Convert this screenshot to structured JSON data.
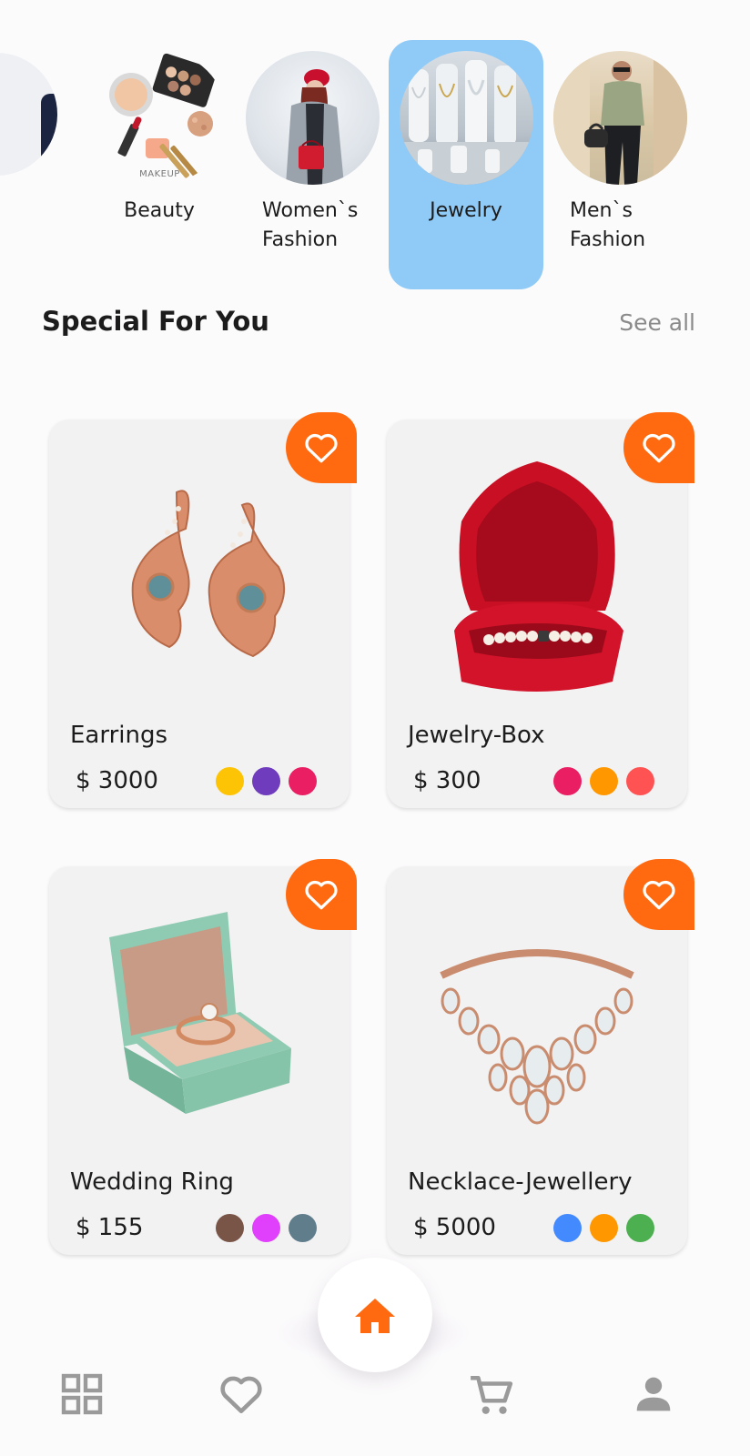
{
  "categories": [
    {
      "label": "Beauty",
      "image_caption": "MAKEUP",
      "active": false
    },
    {
      "label": "Women`s\nFashion",
      "active": false
    },
    {
      "label": "Jewelry",
      "active": true
    },
    {
      "label": "Men`s\nFashion",
      "active": false
    }
  ],
  "section": {
    "title": "Special For You",
    "see_all": "See all"
  },
  "products": [
    {
      "name": "Earrings",
      "price": "$ 3000",
      "colors": [
        "#fdc305",
        "#6e3cbc",
        "#e91e63"
      ]
    },
    {
      "name": "Jewelry-Box",
      "price": "$ 300",
      "colors": [
        "#e91e63",
        "#ff9800",
        "#ff5252"
      ]
    },
    {
      "name": "Wedding Ring",
      "price": "$ 155",
      "colors": [
        "#795548",
        "#e040fb",
        "#607d8b"
      ]
    },
    {
      "name": "Necklace-Jewellery",
      "price": "$ 5000",
      "colors": [
        "#448aff",
        "#ff9800",
        "#4caf50"
      ]
    }
  ],
  "colors": {
    "accent": "#ff6a10",
    "active_category": "#90cbf8",
    "nav_icon": "#9a9a9a"
  },
  "icons": {
    "favorite": "heart-outline-icon",
    "nav": [
      "grid-icon",
      "heart-icon",
      "home-icon",
      "cart-icon",
      "profile-icon"
    ]
  }
}
